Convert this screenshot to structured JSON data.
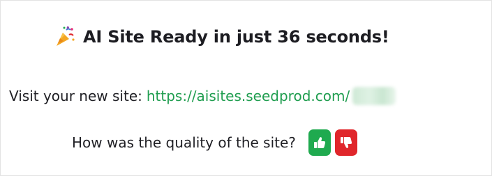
{
  "header": {
    "icon": "party-popper-icon",
    "title": "AI Site Ready in just 36 seconds!"
  },
  "visit": {
    "label": "Visit your new site:",
    "url_visible": "https://aisites.seedprod.com/",
    "link_color": "#1f9d4f"
  },
  "feedback": {
    "question": "How was the quality of the site?",
    "thumbs_up": {
      "icon": "thumbs-up-icon",
      "color": "#1faa4f"
    },
    "thumbs_down": {
      "icon": "thumbs-down-icon",
      "color": "#e0262b"
    }
  }
}
